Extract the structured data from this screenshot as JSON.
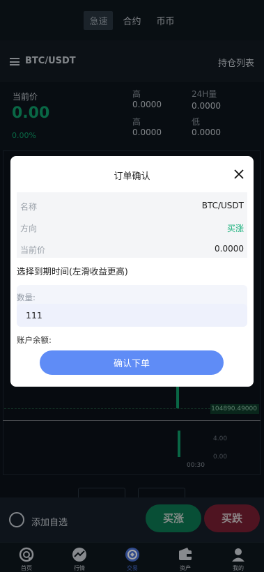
{
  "topnav": {
    "tabs": [
      {
        "label": "急速"
      },
      {
        "label": "合约"
      },
      {
        "label": "币币"
      }
    ]
  },
  "pairbar": {
    "pair": "BTC/USDT",
    "positions_label": "持仓列表"
  },
  "stats": {
    "current_label": "当前价",
    "current_value": "0.00",
    "change_pct": "0.00%",
    "high_label": "高",
    "high_value": "0.0000",
    "high2_label": "高",
    "high2_value": "0.0000",
    "vol_label": "24H量",
    "vol_value": "0.0000",
    "low_label": "低",
    "low_value": "0.0000"
  },
  "chart": {
    "price_tag": "104890.49000",
    "vol_tick_1": "4.00",
    "vol_tick_2": "0.00",
    "time_label": "00:30"
  },
  "actionbar": {
    "add_fav_label": "添加自选",
    "buy_label": "买涨",
    "sell_label": "买跌"
  },
  "tabbar": {
    "items": [
      {
        "label": "首页",
        "icon": "home-icon"
      },
      {
        "label": "行情",
        "icon": "market-icon"
      },
      {
        "label": "交易",
        "icon": "trade-icon"
      },
      {
        "label": "资产",
        "icon": "wallet-icon"
      },
      {
        "label": "我的",
        "icon": "user-icon"
      }
    ],
    "active_index": 2,
    "active_color": "#4a72d8"
  },
  "modal": {
    "title": "订单确认",
    "rows": [
      {
        "key": "名称",
        "value": "BTC/USDT"
      },
      {
        "key": "方向",
        "value": "买涨"
      },
      {
        "key": "当前价",
        "value": "0.0000"
      }
    ],
    "expiry_label": "选择到期时间(左滑收益更高)",
    "qty_label": "数量:",
    "qty_value": "111",
    "balance_label": "账户余额:",
    "confirm_label": "确认下单",
    "up_color": "#16b07a",
    "confirm_color": "#5f8cf6"
  }
}
